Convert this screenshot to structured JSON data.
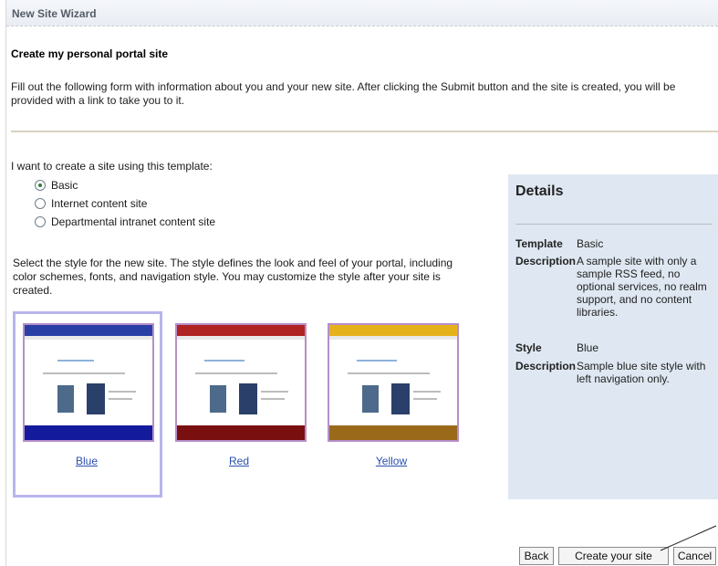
{
  "window": {
    "title": "New Site Wizard"
  },
  "page": {
    "heading": "Create my personal portal site",
    "intro": "Fill out the following form with information about you and your new site. After clicking the Submit button and the site is created, you will be provided with a link to take you to it."
  },
  "template": {
    "label": "I want to create a site using this template:",
    "options": [
      "Basic",
      "Internet content site",
      "Departmental intranet content site"
    ],
    "selected": "Basic"
  },
  "style": {
    "description": "Select the style for the new site. The style defines the look and feel of your portal, including color schemes, fonts, and navigation style. You may customize the style after your site is created.",
    "options": [
      {
        "label": "Blue",
        "header_color": "#2a3fa6",
        "footer_color": "#141a9c"
      },
      {
        "label": "Red",
        "header_color": "#b02323",
        "footer_color": "#7a0f0f"
      },
      {
        "label": "Yellow",
        "header_color": "#e6b21c",
        "footer_color": "#9a6a1a"
      }
    ],
    "selected": "Blue"
  },
  "details": {
    "title": "Details",
    "template_key": "Template",
    "template_value": "Basic",
    "template_desc_key": "Description",
    "template_desc": "A sample site with only a sample RSS feed, no optional services, no realm support, and no content libraries.",
    "style_key": "Style",
    "style_value": "Blue",
    "style_desc_key": "Description",
    "style_desc": "Sample blue site style with left navigation only."
  },
  "buttons": {
    "back": "Back",
    "create": "Create your site",
    "cancel": "Cancel"
  }
}
